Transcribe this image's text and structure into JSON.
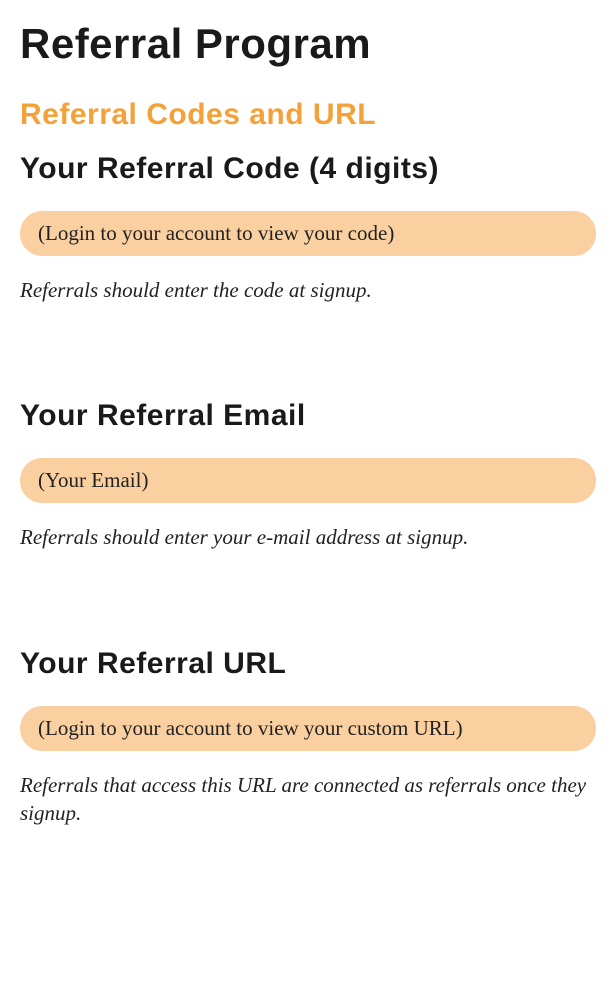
{
  "page": {
    "title": "Referral Program"
  },
  "section": {
    "title": "Referral Codes and URL"
  },
  "referral_code": {
    "heading": "Your Referral Code (4 digits)",
    "value": "(Login to your account to view your code)",
    "hint": "Referrals should enter the code at signup."
  },
  "referral_email": {
    "heading": "Your Referral Email",
    "value": "(Your Email)",
    "hint": "Referrals should enter your e-mail address at signup."
  },
  "referral_url": {
    "heading": "Your Referral URL",
    "value": "(Login to your account to view your custom URL)",
    "hint": "Referrals that access this URL are connected as referrals once they signup."
  }
}
